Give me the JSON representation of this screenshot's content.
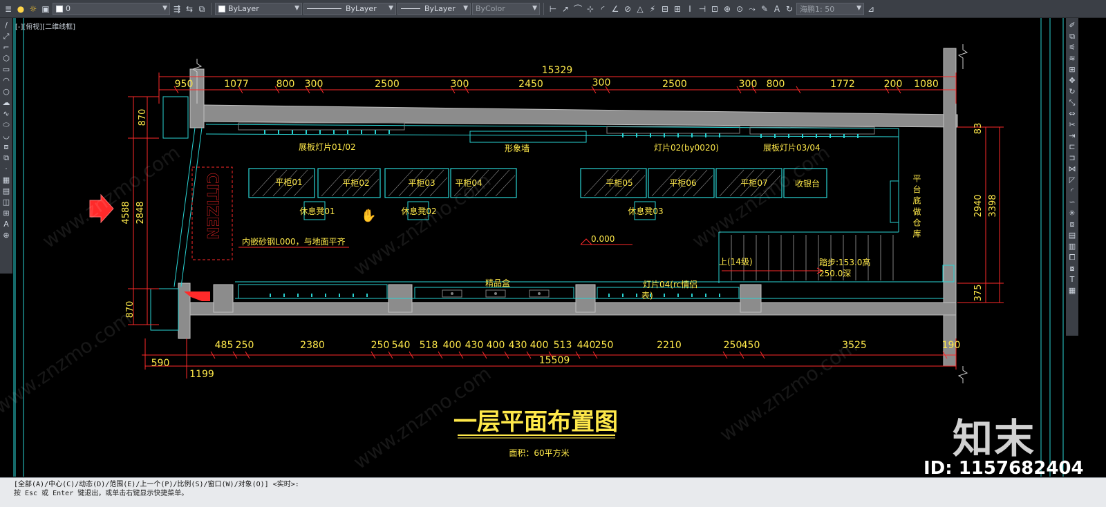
{
  "toolbar": {
    "layer_value": "0",
    "color_value": "ByLayer",
    "linetype_value": "ByLayer",
    "lineweight_value": "ByLayer",
    "plotstyle_value": "ByColor",
    "annotation_scale": "海鹏1: 50"
  },
  "viewport": {
    "label": "[-][俯视][二维线框]"
  },
  "drawing": {
    "top_total": "15329",
    "top_dims": [
      "950",
      "1077",
      "800",
      "300",
      "2500",
      "300",
      "2450",
      "300",
      "2500",
      "300",
      "800",
      "1772",
      "200",
      "1080"
    ],
    "bottom_dims": [
      "485",
      "250",
      "2380",
      "250",
      "540",
      "518",
      "400",
      "430",
      "400",
      "430",
      "400",
      "513",
      "440",
      "250",
      "2210",
      "250",
      "450",
      "3525",
      "190"
    ],
    "bottom_total": "15509",
    "extra_dims": [
      "590",
      "1199"
    ],
    "left_dims": [
      "870",
      "4588",
      "2848",
      "870"
    ],
    "right_dims": [
      "83",
      "2940",
      "3398",
      "375"
    ],
    "counters": [
      "平柜01",
      "平柜02",
      "平柜03",
      "平柜04",
      "平柜05",
      "平柜06",
      "平柜07",
      "收银台"
    ],
    "stools": [
      "休息凳01",
      "休息凳02",
      "休息凳03"
    ],
    "labels": {
      "panel_light_1": "展板灯片01/02",
      "image_wall": "形象墙",
      "light_02": "灯片02(by0020)",
      "panel_light_2": "展板灯片03/04",
      "storage_vertical": "平台底做仓库",
      "steel_note": "内嵌砂钢L000，与地面平齐",
      "level": "0.000",
      "stairs_up": "上(14级)",
      "step_size_1": "踏步:153.0高",
      "step_size_2": "250.0深",
      "gift_box": "精品盒",
      "light_04_1": "灯片04(rc情侣",
      "light_04_2": "表)",
      "brand": "CITIZEN"
    },
    "title": "一层平面布置图",
    "subtitle": "面积：60平方米"
  },
  "command_line": {
    "line1": "[全部(A)/中心(C)/动态(D)/范围(E)/上一个(P)/比例(S)/窗口(W)/对象(O)] <实时>:",
    "line2": "按 Esc 或 Enter 键退出，或单击右键显示快捷菜单。"
  },
  "watermark": {
    "logo": "知末",
    "id": "ID: 1157682404",
    "site": "www.znzmo.com"
  },
  "colors": {
    "background": "#000000",
    "wall": "#9a9a9a",
    "cyan": "#2ad4d4",
    "dim_red": "#ff2a2a",
    "text_yellow": "#ffe94a",
    "toolbar": "#3b3f46"
  }
}
